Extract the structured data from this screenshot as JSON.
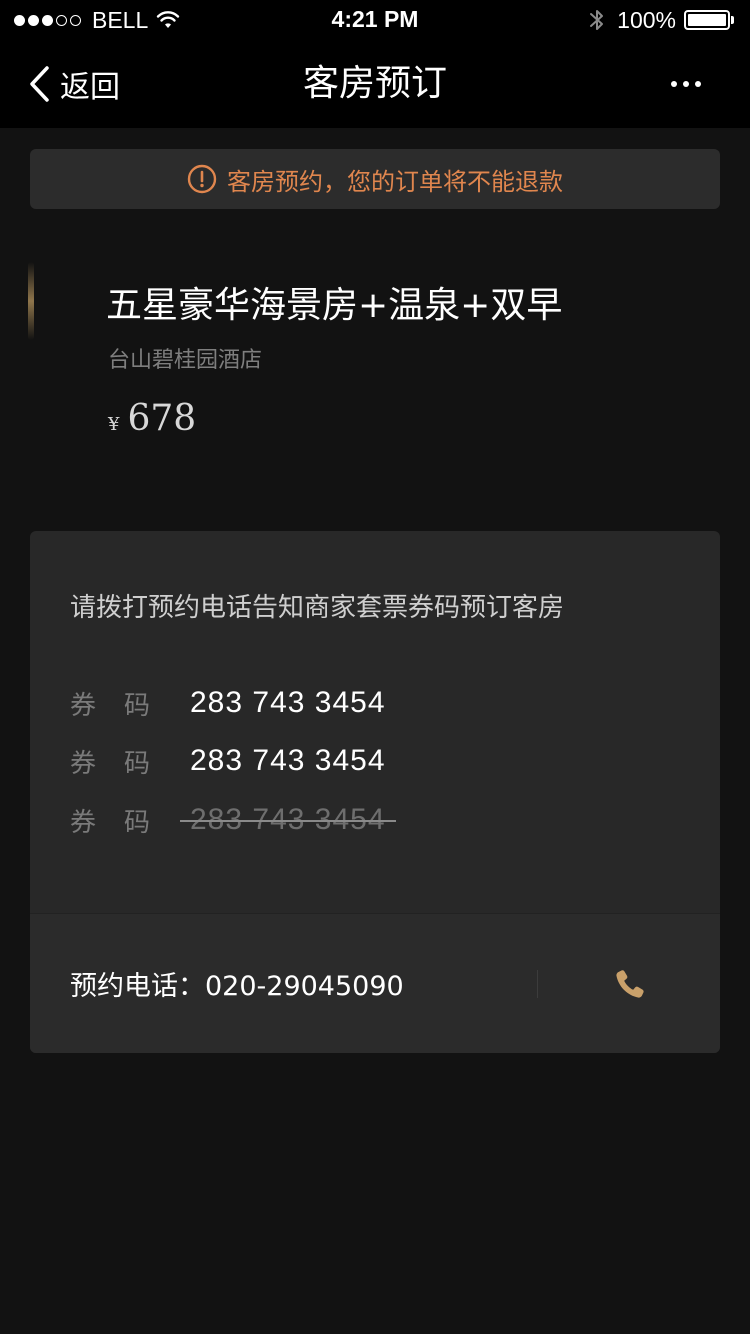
{
  "status_bar": {
    "carrier": "BELL",
    "time": "4:21 PM",
    "battery": "100%",
    "battery_level": 1.0,
    "signal_bars_filled": 3,
    "signal_bars_total": 5
  },
  "nav": {
    "back_label": "返回",
    "title": "客房预订"
  },
  "notice": {
    "text": "客房预约，您的订单将不能退款",
    "color": "#e0864e",
    "icon": "alert-circle-icon"
  },
  "room": {
    "title": "五星豪华海景房+温泉+双早",
    "hotel": "台山碧桂园酒店",
    "currency_symbol": "¥",
    "price": "678"
  },
  "vouchers": {
    "instruction": "请拨打预约电话告知商家套票券码预订客房",
    "items": [
      {
        "label": "券码",
        "code": "283 743 3454",
        "used": false
      },
      {
        "label": "券码",
        "code": "283 743 3454",
        "used": false
      },
      {
        "label": "券码",
        "code": "283 743 3454",
        "used": true
      }
    ]
  },
  "contact": {
    "label": "预约电话：020-29045090",
    "icon": "phone-icon",
    "icon_color": "#c9a06a"
  }
}
